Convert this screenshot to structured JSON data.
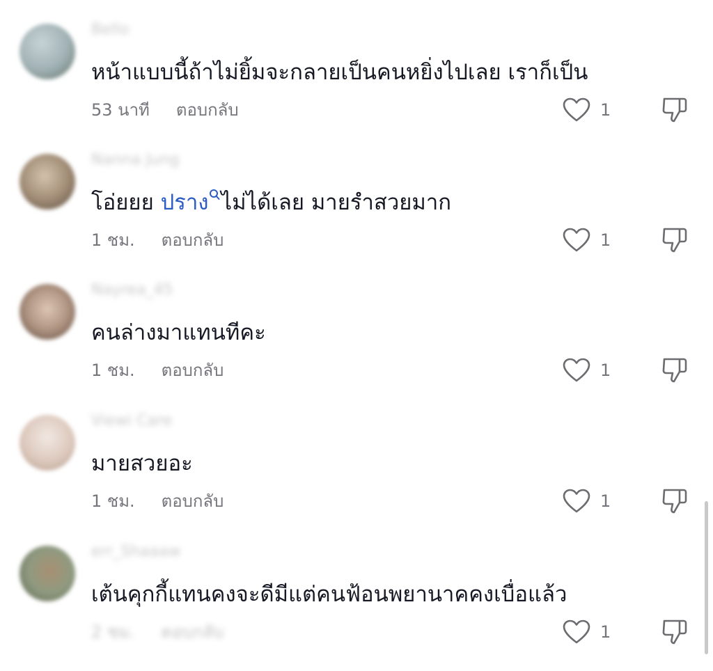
{
  "comments": [
    {
      "username": "Bello",
      "text": "หน้าแบบนี้ถ้าไม่ยิ้มจะกลายเป็นคนหยิ่งไปเลย เราก็เป็น",
      "time": "53 นาที",
      "reply_label": "ตอบกลับ",
      "likes": "1",
      "avatar_colors": [
        "#b9c8cc",
        "#62756a"
      ]
    },
    {
      "username": "Nanna Jung",
      "text_before": "โอ่ยยย ",
      "mention": "ปราง",
      "text_after": "ไม่ได้เลย มายรำสวยมาก",
      "time": "1 ชม.",
      "reply_label": "ตอบกลับ",
      "likes": "1",
      "avatar_colors": [
        "#c7b7a0",
        "#6c5e50"
      ]
    },
    {
      "username": "Nayrea_45",
      "text": "คนล่างมาแทนทีคะ",
      "time": "1 ชม.",
      "reply_label": "ตอบกลับ",
      "likes": "1",
      "avatar_colors": [
        "#d6c2b2",
        "#7e6654"
      ]
    },
    {
      "username": "Viewi Care",
      "text": "มายสวยอะ",
      "time": "1 ชม.",
      "reply_label": "ตอบกลับ",
      "likes": "1",
      "avatar_colors": [
        "#ece3dc",
        "#c4ada0"
      ]
    },
    {
      "username": "err_Shaaaw",
      "text": "เต้นคุกกี้แทนคงจะดีมีแต่คนฟ้อนพยานาคคงเบื่อแล้ว",
      "time": "2 ชม.",
      "reply_label": "ตอบกลับ",
      "likes": "1",
      "avatar_colors": [
        "#b8c0a8",
        "#6c5b44"
      ]
    }
  ],
  "icons": {
    "like": "heart-outline-icon",
    "dislike": "thumbs-down-icon",
    "mention_search": "search-icon"
  },
  "colors": {
    "text": "#161823",
    "meta": "#75757c",
    "mention": "#2b5cc4",
    "icon": "#6b6b70"
  }
}
